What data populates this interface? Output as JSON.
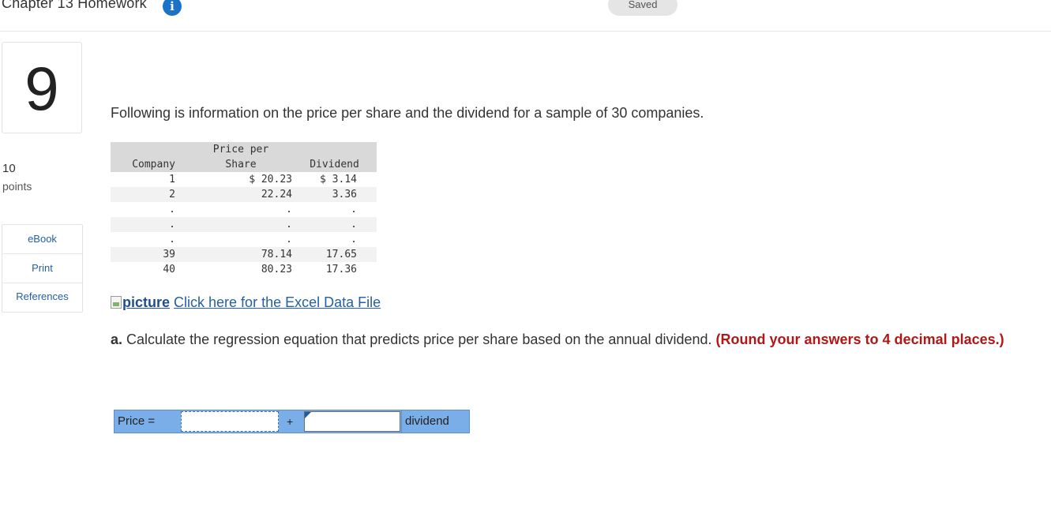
{
  "header": {
    "title": "Chapter 13 Homework",
    "info_icon": "i",
    "saved_label": "Saved"
  },
  "sidebar": {
    "question_number": "9",
    "points_value": "10",
    "points_label": "points",
    "links": [
      {
        "label": "eBook"
      },
      {
        "label": "Print"
      },
      {
        "label": "References"
      }
    ]
  },
  "main": {
    "intro": "Following is information on the price per share and the dividend for a sample of 30 companies.",
    "table": {
      "headers": [
        [
          "",
          "Company"
        ],
        [
          "Price per",
          "Share"
        ],
        [
          "",
          "Dividend"
        ]
      ],
      "rows": [
        [
          "1",
          "$ 20.23",
          "$ 3.14"
        ],
        [
          "2",
          "22.24",
          "3.36"
        ],
        [
          ".",
          ".",
          "."
        ],
        [
          ".",
          ".",
          "."
        ],
        [
          ".",
          ".",
          "."
        ],
        [
          "39",
          "78.14",
          "17.65"
        ],
        [
          "40",
          "80.23",
          "17.36"
        ]
      ]
    },
    "excel_link": {
      "image_alt": "picture",
      "text": "Click here for the Excel Data File"
    },
    "question": {
      "label": "a.",
      "text": "Calculate the regression equation that predicts price per share based on the annual dividend.",
      "emphasis": "(Round your answers to 4 decimal places.)"
    },
    "equation": {
      "label": "Price =",
      "intercept_value": "",
      "plus": "+",
      "slope_value": "",
      "variable": "dividend"
    }
  }
}
